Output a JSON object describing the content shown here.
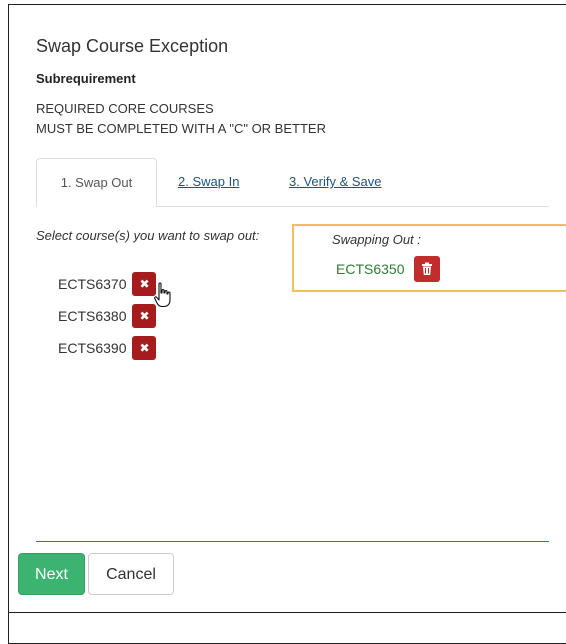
{
  "dialog": {
    "title": "Swap Course Exception",
    "subrequirement_label": "Subrequirement",
    "subrequirement_lines": [
      "REQUIRED CORE COURSES",
      "MUST BE COMPLETED WITH A \"C\" OR BETTER"
    ]
  },
  "tabs": [
    {
      "label": "1. Swap Out",
      "active": true
    },
    {
      "label": "2. Swap In",
      "active": false
    },
    {
      "label": "3. Verify & Save",
      "active": false
    }
  ],
  "swap_out": {
    "instructions": "Select course(s) you want to swap out:",
    "courses": [
      {
        "code": "ECTS6370",
        "action_icon": "remove-icon"
      },
      {
        "code": "ECTS6380",
        "action_icon": "remove-icon"
      },
      {
        "code": "ECTS6390",
        "action_icon": "remove-icon"
      }
    ]
  },
  "swapping_out_panel": {
    "label": "Swapping Out :",
    "courses": [
      {
        "code": "ECTS6350",
        "action_icon": "trash-icon"
      }
    ]
  },
  "footer": {
    "next_label": "Next",
    "cancel_label": "Cancel"
  },
  "colors": {
    "accent_green": "#3cb371",
    "danger_red": "#a61c1c",
    "link_blue": "#23527c",
    "highlight_border": "#f0c060",
    "course_green": "#2e7d32"
  }
}
